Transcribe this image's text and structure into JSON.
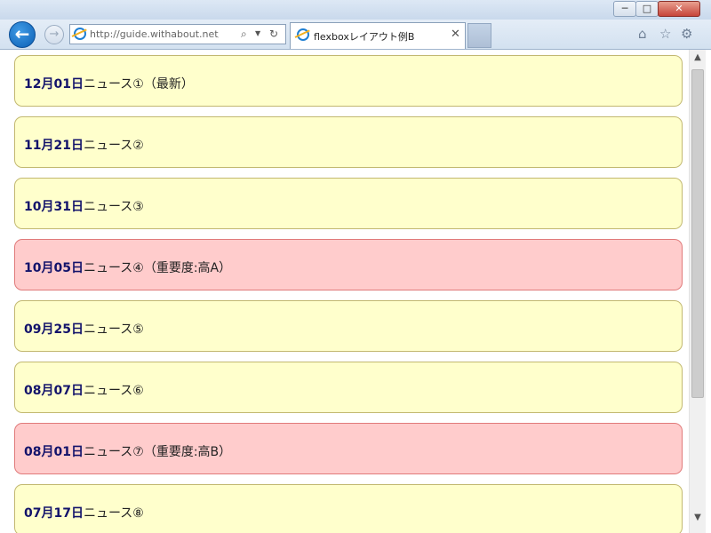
{
  "window": {
    "minimize_glyph": "─",
    "maximize_glyph": "□",
    "close_glyph": "✕"
  },
  "navbar": {
    "back_glyph": "←",
    "forward_glyph": "→",
    "address": "http://guide.withabout.net/",
    "search_glyph": "⌕",
    "dropdown_glyph": "▼",
    "refresh_glyph": "↻"
  },
  "tab": {
    "title": "flexboxレイアウト例B",
    "close_glyph": "✕"
  },
  "toolbar": {
    "home_glyph": "⌂",
    "star_glyph": "☆",
    "gear_glyph": "⚙"
  },
  "news": [
    {
      "date": "12月01日",
      "title": "ニュース①（最新）",
      "important": false
    },
    {
      "date": "11月21日",
      "title": "ニュース②",
      "important": false
    },
    {
      "date": "10月31日",
      "title": "ニュース③",
      "important": false
    },
    {
      "date": "10月05日",
      "title": "ニュース④（重要度:高A）",
      "important": true
    },
    {
      "date": "09月25日",
      "title": "ニュース⑤",
      "important": false
    },
    {
      "date": "08月07日",
      "title": "ニュース⑥",
      "important": false
    },
    {
      "date": "08月01日",
      "title": "ニュース⑦（重要度:高B）",
      "important": true
    },
    {
      "date": "07月17日",
      "title": "ニュース⑧",
      "important": false
    }
  ],
  "colors": {
    "normal_bg": "#ffffcc",
    "important_bg": "#ffcccc",
    "date_text": "#13136b"
  },
  "scrollbar": {
    "up_glyph": "▲",
    "down_glyph": "▼"
  }
}
